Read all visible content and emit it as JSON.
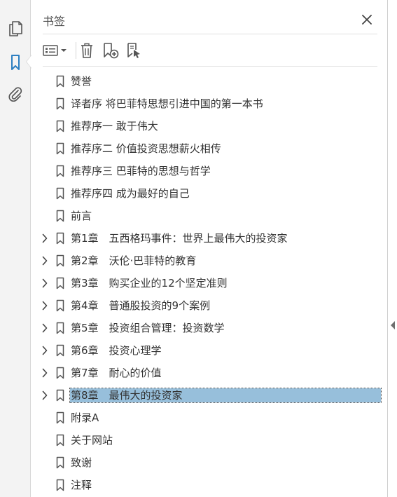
{
  "sidebar": {
    "tools": [
      {
        "icon": "pages-icon",
        "label": "pages"
      },
      {
        "icon": "bookmark-icon",
        "label": "bookmarks",
        "active": true
      },
      {
        "icon": "attachment-icon",
        "label": "attachments"
      }
    ]
  },
  "panel": {
    "title": "书签",
    "close_icon": "close-icon",
    "toolbar": [
      {
        "icon": "options-menu-icon"
      },
      {
        "icon": "delete-bookmark-icon"
      },
      {
        "icon": "new-bookmark-icon"
      },
      {
        "icon": "new-bookmark-from-structure-icon"
      }
    ]
  },
  "bookmarks": [
    {
      "label": "赞誉",
      "expandable": false
    },
    {
      "label": "译者序 将巴菲特思想引进中国的第一本书",
      "expandable": false
    },
    {
      "label": "推荐序一 敢于伟大",
      "expandable": false
    },
    {
      "label": "推荐序二 价值投资思想薪火相传",
      "expandable": false
    },
    {
      "label": "推荐序三 巴菲特的思想与哲学",
      "expandable": false
    },
    {
      "label": "推荐序四 成为最好的自己",
      "expandable": false
    },
    {
      "label": "前言",
      "expandable": false
    },
    {
      "label": "第1章　五西格玛事件：世界上最伟大的投资家",
      "expandable": true
    },
    {
      "label": "第2章　沃伦·巴菲特的教育",
      "expandable": true
    },
    {
      "label": "第3章　购买企业的12个坚定准则",
      "expandable": true
    },
    {
      "label": "第4章　普通股投资的9个案例",
      "expandable": true
    },
    {
      "label": "第5章　投资组合管理：投资数学",
      "expandable": true
    },
    {
      "label": "第6章　投资心理学",
      "expandable": true
    },
    {
      "label": "第7章　耐心的价值",
      "expandable": true
    },
    {
      "label": "第8章　最伟大的投资家",
      "expandable": true,
      "selected": true
    },
    {
      "label": "附录A",
      "expandable": false
    },
    {
      "label": "关于网站",
      "expandable": false
    },
    {
      "label": "致谢",
      "expandable": false
    },
    {
      "label": "注释",
      "expandable": false
    }
  ],
  "colors": {
    "accent": "#2d7fc1",
    "selection": "#97bfdb",
    "rail_bg": "#f3f3f3"
  }
}
